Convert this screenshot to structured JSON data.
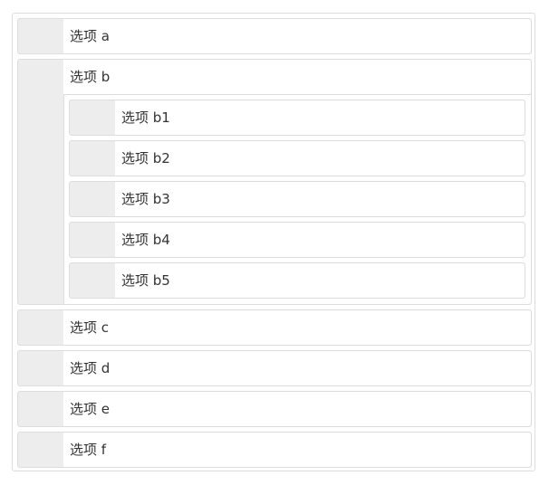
{
  "list": {
    "items": [
      {
        "label": "选项 a"
      },
      {
        "label": "选项 b",
        "children": [
          {
            "label": "选项 b1"
          },
          {
            "label": "选项 b2"
          },
          {
            "label": "选项 b3"
          },
          {
            "label": "选项 b4"
          },
          {
            "label": "选项 b5"
          }
        ]
      },
      {
        "label": "选项 c"
      },
      {
        "label": "选项 d"
      },
      {
        "label": "选项 e"
      },
      {
        "label": "选项 f"
      }
    ]
  }
}
